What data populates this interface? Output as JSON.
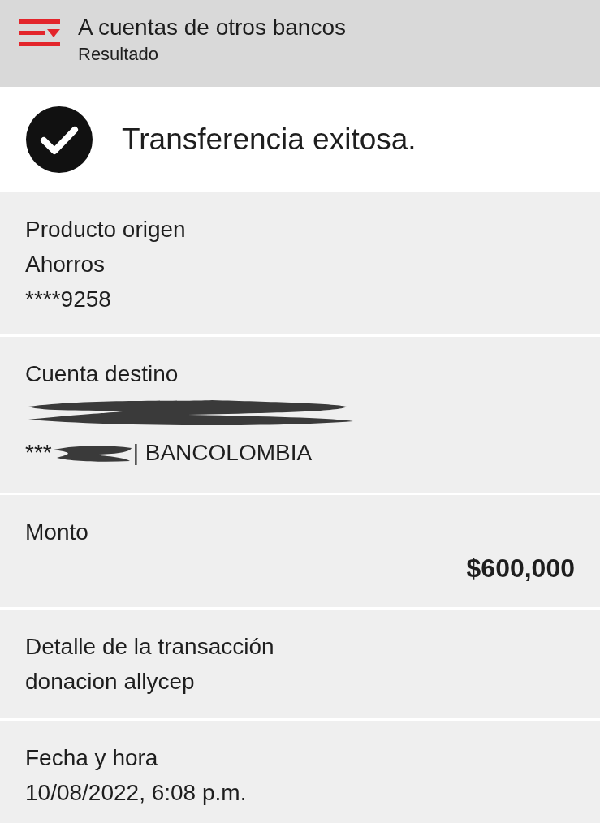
{
  "header": {
    "title": "A cuentas de otros bancos",
    "subtitle": "Resultado"
  },
  "result": {
    "message": "Transferencia exitosa.",
    "success": true
  },
  "sections": [
    {
      "kind": "lines",
      "label": "Producto origen",
      "lines": [
        "Ahorros",
        "****9258"
      ]
    },
    {
      "kind": "redacted",
      "label": "Cuenta destino",
      "prefix": "***",
      "suffix": "| BANCOLOMBIA"
    },
    {
      "kind": "amount",
      "label": "Monto",
      "amount": "$600,000"
    },
    {
      "kind": "lines",
      "label": "Detalle de la transacción",
      "lines": [
        "donacion allycep"
      ]
    },
    {
      "kind": "lines",
      "label": "Fecha y hora",
      "lines": [
        "10/08/2022, 6:08 p.m."
      ]
    }
  ]
}
